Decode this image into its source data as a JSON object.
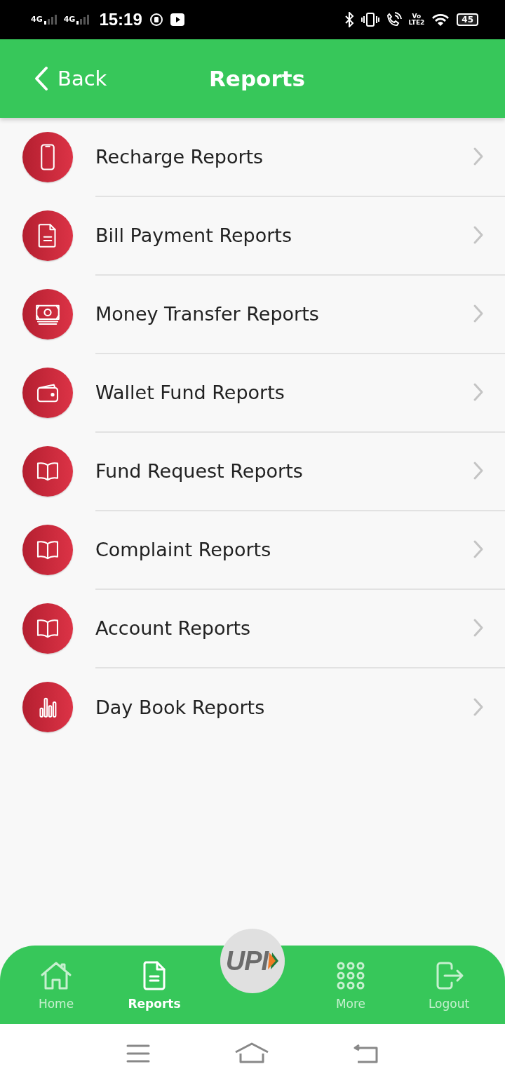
{
  "status_bar": {
    "networks": [
      "4G",
      "4G"
    ],
    "time": "15:19",
    "volte": {
      "top": "Vo",
      "bottom": "LTE2"
    },
    "battery": "45"
  },
  "header": {
    "back": "Back",
    "title": "Reports"
  },
  "items": [
    {
      "label": "Recharge Reports",
      "kind": "phone"
    },
    {
      "label": "Bill Payment Reports",
      "kind": "document"
    },
    {
      "label": "Money Transfer Reports",
      "kind": "cash"
    },
    {
      "label": "Wallet Fund Reports",
      "kind": "wallet"
    },
    {
      "label": "Fund Request Reports",
      "kind": "book"
    },
    {
      "label": "Complaint Reports",
      "kind": "book"
    },
    {
      "label": "Account Reports",
      "kind": "book"
    },
    {
      "label": "Day Book Reports",
      "kind": "chart"
    }
  ],
  "bottom_nav": {
    "tabs": [
      {
        "label": "Home",
        "kind": "home",
        "selected": false
      },
      {
        "label": "Reports",
        "kind": "document",
        "selected": true
      },
      {
        "label": "More",
        "kind": "grid",
        "selected": false
      },
      {
        "label": "Logout",
        "kind": "logout",
        "selected": false
      }
    ],
    "center": {
      "label": "UPI"
    }
  }
}
